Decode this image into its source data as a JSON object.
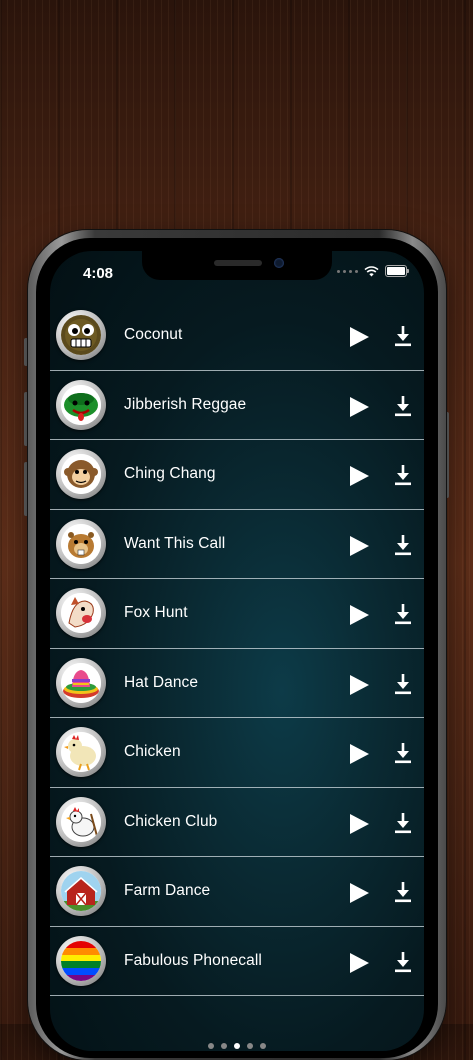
{
  "status_bar": {
    "time": "4:08"
  },
  "ringtones": [
    {
      "name": "Coconut",
      "icon": "coconut-face-icon"
    },
    {
      "name": "Jibberish Reggae",
      "icon": "reggae-frog-icon"
    },
    {
      "name": "Ching Chang",
      "icon": "monkey-icon"
    },
    {
      "name": "Want This Call",
      "icon": "beaver-icon"
    },
    {
      "name": "Fox Hunt",
      "icon": "fox-icon"
    },
    {
      "name": "Hat Dance",
      "icon": "sombrero-icon"
    },
    {
      "name": "Chicken",
      "icon": "chicken-icon"
    },
    {
      "name": "Chicken Club",
      "icon": "chicken-club-icon"
    },
    {
      "name": "Farm Dance",
      "icon": "barn-icon"
    },
    {
      "name": "Fabulous Phonecall",
      "icon": "rainbow-icon"
    }
  ],
  "pagination": {
    "pages": 5,
    "active_index": 2
  },
  "colors": {
    "screen_bg": "#0a2a33",
    "divider": "#d2dce1",
    "text": "#ffffff"
  }
}
